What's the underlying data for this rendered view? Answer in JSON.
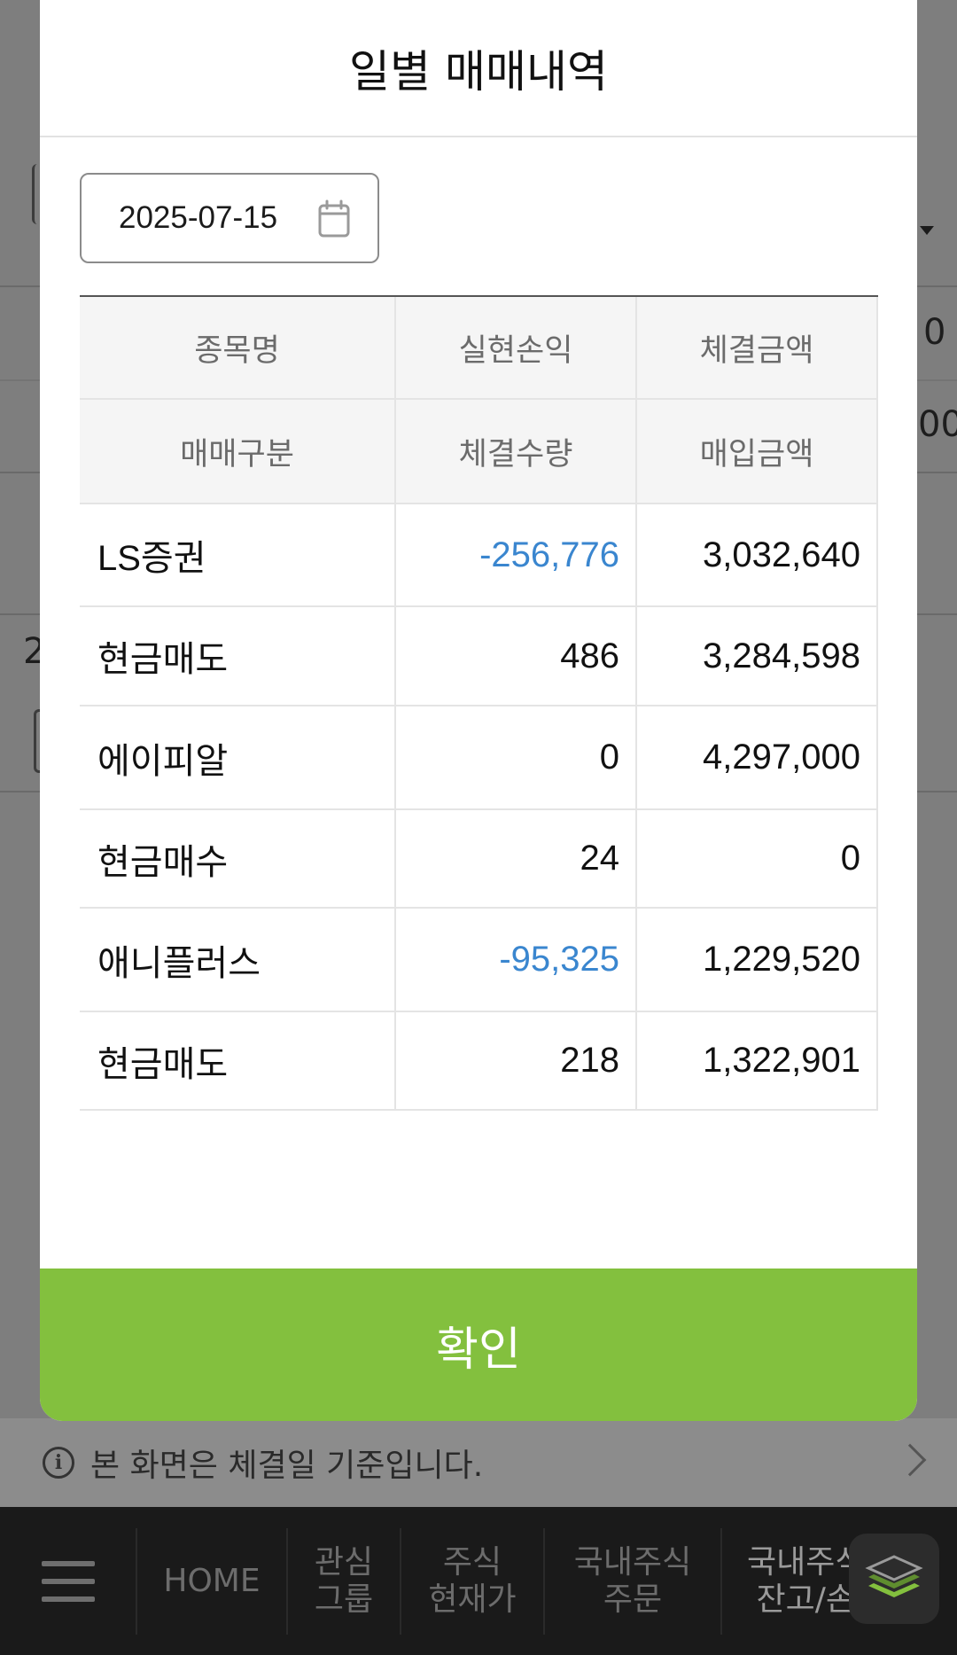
{
  "modal": {
    "title": "일별 매매내역",
    "date": "2025-07-15",
    "date_icon": "calendar-icon",
    "headers": {
      "row1": [
        "종목명",
        "실현손익",
        "체결금액"
      ],
      "row2": [
        "매매구분",
        "체결수량",
        "매입금액"
      ]
    },
    "rows": [
      [
        "LS증권",
        "-256,776",
        "3,032,640"
      ],
      [
        "현금매도",
        "486",
        "3,284,598"
      ],
      [
        "에이피알",
        "0",
        "4,297,000"
      ],
      [
        "현금매수",
        "24",
        "0"
      ],
      [
        "애니플러스",
        "-95,325",
        "1,229,520"
      ],
      [
        "현금매도",
        "218",
        "1,322,901"
      ]
    ],
    "confirm_label": "확인",
    "colors": {
      "confirm": "#83c03e",
      "negative": "#3a86cf"
    }
  },
  "notice": {
    "icon": "info-icon",
    "text": "본 화면은 체결일 기준입니다."
  },
  "background_fragments": {
    "left_top": "",
    "right_top": "0",
    "right_second": "00",
    "left_row": "2"
  },
  "bottom_nav": {
    "menu_icon": "hamburger-menu-icon",
    "items": [
      "HOME",
      "관심\n그룹",
      "주식\n현재가",
      "국내주식\n주문",
      "국내주식\n잔고/손"
    ],
    "fab_icon": "layers-icon"
  }
}
